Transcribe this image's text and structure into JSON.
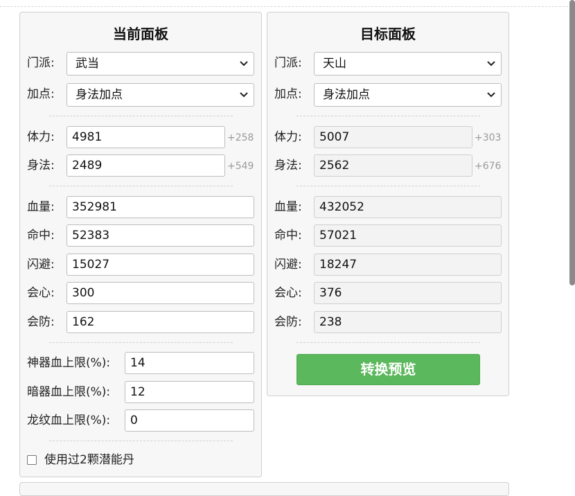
{
  "current": {
    "title": "当前面板",
    "school_label": "门派:",
    "school_value": "武当",
    "point_label": "加点:",
    "point_value": "身法加点",
    "attrs": [
      {
        "label": "体力:",
        "value": "4981",
        "bonus": "+258"
      },
      {
        "label": "身法:",
        "value": "2489",
        "bonus": "+549"
      }
    ],
    "stats": [
      {
        "label": "血量:",
        "value": "352981"
      },
      {
        "label": "命中:",
        "value": "52383"
      },
      {
        "label": "闪避:",
        "value": "15027"
      },
      {
        "label": "会心:",
        "value": "300"
      },
      {
        "label": "会防:",
        "value": "162"
      }
    ],
    "limits": [
      {
        "label": "神器血上限(%):",
        "value": "14"
      },
      {
        "label": "暗器血上限(%):",
        "value": "12"
      },
      {
        "label": "龙纹血上限(%):",
        "value": "0"
      }
    ],
    "checkbox_label": "使用过2颗潜能丹"
  },
  "target": {
    "title": "目标面板",
    "school_label": "门派:",
    "school_value": "天山",
    "point_label": "加点:",
    "point_value": "身法加点",
    "attrs": [
      {
        "label": "体力:",
        "value": "5007",
        "bonus": "+303"
      },
      {
        "label": "身法:",
        "value": "2562",
        "bonus": "+676"
      }
    ],
    "stats": [
      {
        "label": "血量:",
        "value": "432052"
      },
      {
        "label": "命中:",
        "value": "57021"
      },
      {
        "label": "闪避:",
        "value": "18247"
      },
      {
        "label": "会心:",
        "value": "376"
      },
      {
        "label": "会防:",
        "value": "238"
      }
    ],
    "convert_button": "转换预览"
  }
}
